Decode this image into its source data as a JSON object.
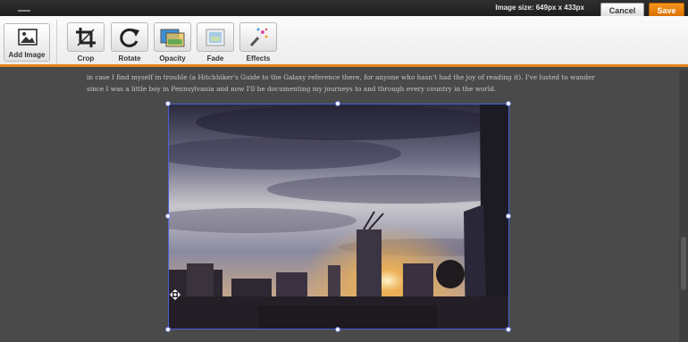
{
  "header": {
    "image_size": "Image size: 649px x 433px",
    "cancel_label": "Cancel",
    "save_label": "Save"
  },
  "toolbar": {
    "add_image": "Add Image",
    "tools": [
      {
        "label": "Crop",
        "icon": "crop-icon"
      },
      {
        "label": "Rotate",
        "icon": "rotate-icon"
      },
      {
        "label": "Opacity",
        "icon": "opacity-icon"
      },
      {
        "label": "Fade",
        "icon": "fade-icon"
      },
      {
        "label": "Effects",
        "icon": "magic-wand-icon"
      }
    ]
  },
  "content": {
    "line1": "in case I find myself in trouble (a Hitchhiker's Guide to the Galaxy reference there, for anyone who hasn't had the joy of reading it). I've lusted to wander",
    "line2": "since I was a little boy in Pennsylvania and now I'll be documenting my journeys to and through every country in the world."
  },
  "colors": {
    "accent": "#e7841c",
    "save": "#f7941d",
    "selection": "#4a5fd8"
  }
}
